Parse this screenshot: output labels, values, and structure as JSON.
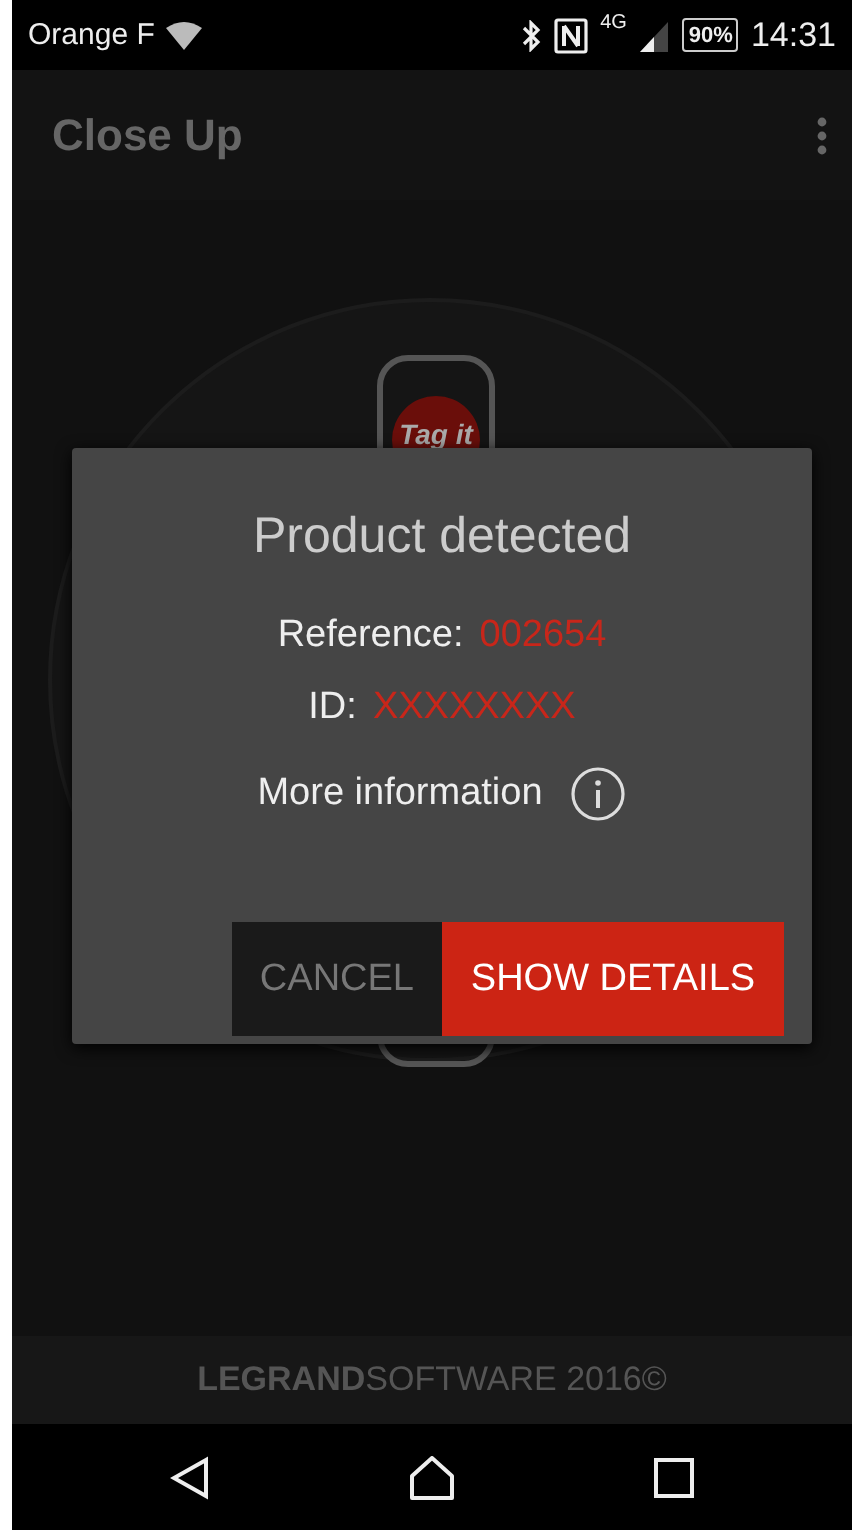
{
  "status_bar": {
    "carrier": "Orange F",
    "network": "4G",
    "battery": "90%",
    "time": "14:31"
  },
  "app_bar": {
    "title": "Close Up"
  },
  "scene": {
    "tag_label": "Tag it"
  },
  "dialog": {
    "title": "Product detected",
    "fields": [
      {
        "label": "Reference:",
        "value": "002654"
      },
      {
        "label": "ID:",
        "value": "XXXXXXXX"
      }
    ],
    "info_link": "More information",
    "buttons": [
      {
        "label": "CANCEL",
        "kind": "secondary"
      },
      {
        "label": "SHOW DETAILS",
        "kind": "primary"
      }
    ]
  },
  "footer": {
    "text": "**LEGRAND**SOFTWARE 2016©"
  }
}
